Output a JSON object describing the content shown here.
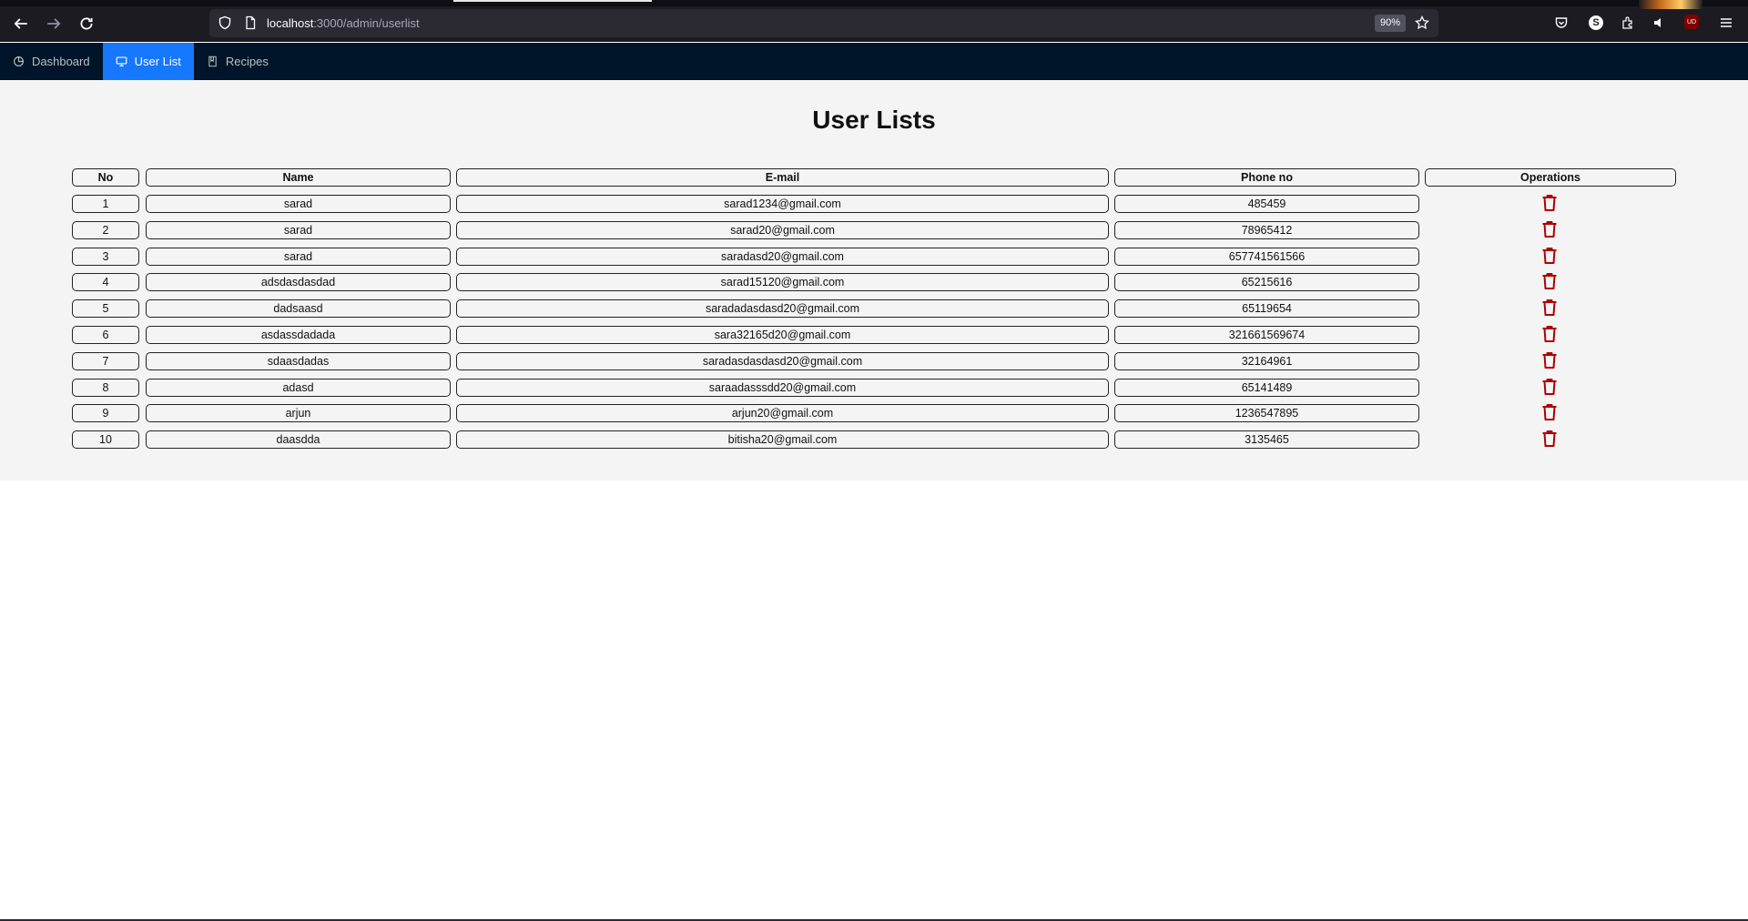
{
  "browser": {
    "url_host": "localhost",
    "url_rest": ":3000/admin/userlist",
    "zoom": "90%",
    "avatar_letter": "S",
    "ublock_label": "UD"
  },
  "nav": {
    "items": [
      {
        "label": "Dashboard",
        "icon": "pie-chart-icon",
        "active": false
      },
      {
        "label": "User List",
        "icon": "desktop-icon",
        "active": true
      },
      {
        "label": "Recipes",
        "icon": "book-icon",
        "active": false
      }
    ]
  },
  "page": {
    "title": "User Lists"
  },
  "table": {
    "headers": {
      "no": "No",
      "name": "Name",
      "email": "E-mail",
      "phone": "Phone no",
      "operations": "Operations"
    },
    "rows": [
      {
        "no": "1",
        "name": "sarad",
        "email": "sarad1234@gmail.com",
        "phone": "485459"
      },
      {
        "no": "2",
        "name": "sarad",
        "email": "sarad20@gmail.com",
        "phone": "78965412"
      },
      {
        "no": "3",
        "name": "sarad",
        "email": "saradasd20@gmail.com",
        "phone": "657741561566"
      },
      {
        "no": "4",
        "name": "adsdasdasdad",
        "email": "sarad15120@gmail.com",
        "phone": "65215616"
      },
      {
        "no": "5",
        "name": "dadsaasd",
        "email": "saradadasdasd20@gmail.com",
        "phone": "65119654"
      },
      {
        "no": "6",
        "name": "asdassdadada",
        "email": "sara32165d20@gmail.com",
        "phone": "321661569674"
      },
      {
        "no": "7",
        "name": "sdaasdadas",
        "email": "saradasdasdasd20@gmail.com",
        "phone": "32164961"
      },
      {
        "no": "8",
        "name": "adasd",
        "email": "saraadasssdd20@gmail.com",
        "phone": "65141489"
      },
      {
        "no": "9",
        "name": "arjun",
        "email": "arjun20@gmail.com",
        "phone": "1236547895"
      },
      {
        "no": "10",
        "name": "daasdda",
        "email": "bitisha20@gmail.com",
        "phone": "3135465"
      }
    ],
    "delete_icon": "trash-icon",
    "delete_color": "#b00000"
  }
}
